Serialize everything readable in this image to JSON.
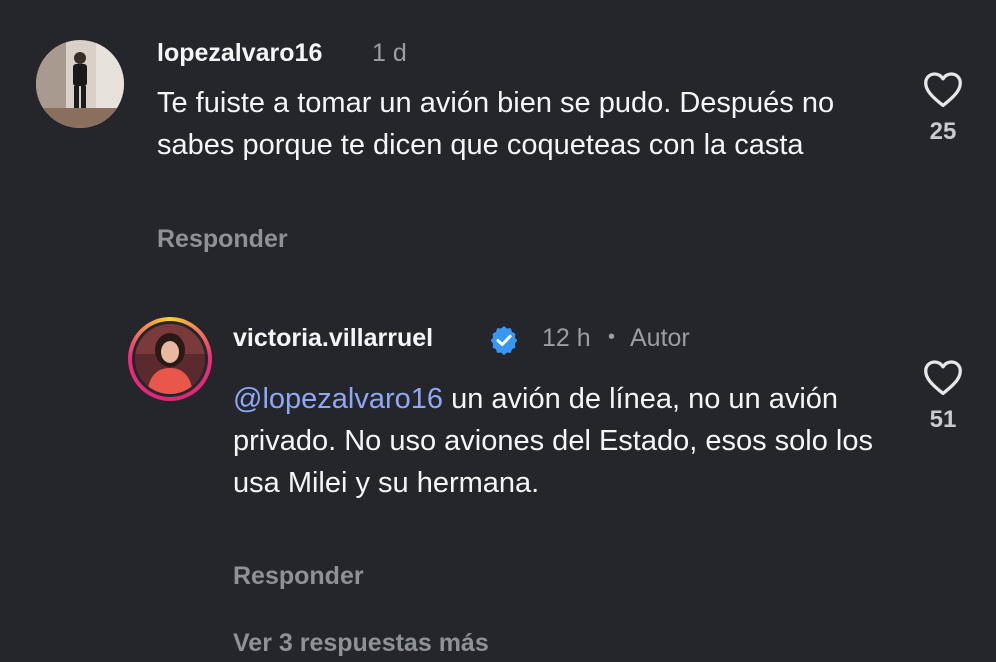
{
  "comments": [
    {
      "username": "lopezalvaro16",
      "time": "1 d",
      "text": "Te fuiste a tomar un avión bien se pudo. Después no sabes porque te dicen que coqueteas con la casta",
      "reply_label": "Responder",
      "likes": "25"
    },
    {
      "username": "victoria.villarruel",
      "time": "12 h",
      "separator": "•",
      "author_badge": "Autor",
      "mention": "@lopezalvaro16",
      "text": " un avión de línea, no un avión privado. No uso aviones del Estado, esos solo los usa Milei y su hermana.",
      "reply_label": "Responder",
      "likes": "51",
      "verified": true
    }
  ],
  "view_more": "Ver 3 respuestas más",
  "colors": {
    "background": "#24262b",
    "mention": "#8fa8f5",
    "verified": "#3897f0",
    "muted": "#8e9198"
  }
}
